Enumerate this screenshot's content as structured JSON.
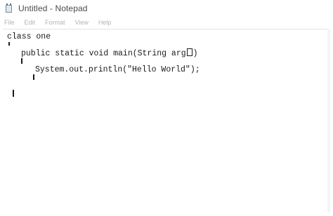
{
  "window": {
    "title": "Untitled - Notepad"
  },
  "menu": {
    "items": [
      "File",
      "Edit",
      "Format",
      "View",
      "Help"
    ]
  },
  "editor": {
    "line1": "class one",
    "line2_before": "public static void main(String arg",
    "line2_after": ")",
    "line3": "System.out.println(\"Hello World\");"
  },
  "icons": {
    "app_icon": "notepad-icon"
  }
}
